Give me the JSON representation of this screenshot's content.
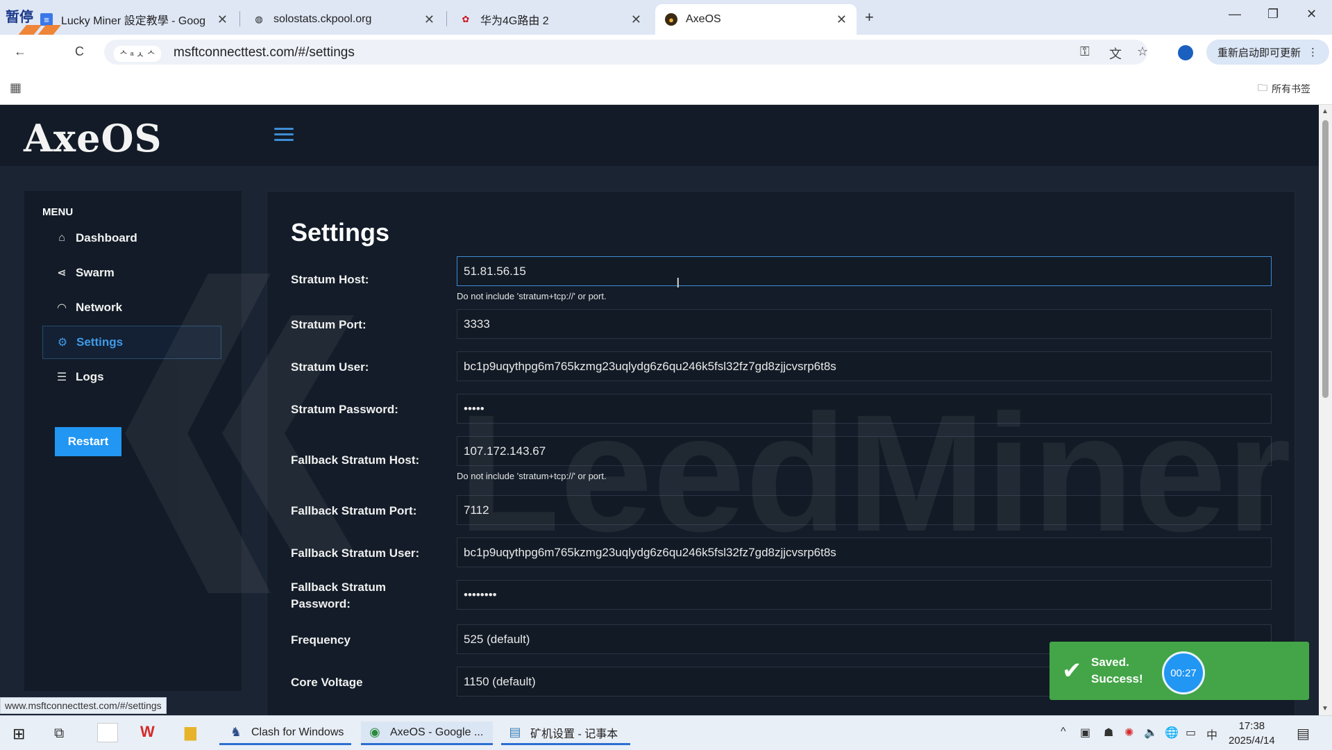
{
  "browser": {
    "tabs": [
      {
        "title": "Lucky Miner 設定教學 - Goog",
        "icon": "google-docs-icon"
      },
      {
        "title": "solostats.ckpool.org",
        "icon": "globe-icon"
      },
      {
        "title": "华为4G路由 2",
        "icon": "huawei-icon"
      },
      {
        "title": "AxeOS",
        "icon": "axeos-icon"
      }
    ],
    "corner_overlay_text": "暂停",
    "url": "msftconnecttest.com/#/settings",
    "site_chip": "ᄉ ᵃ ㅅ ᄉ",
    "update_button": "重新启动即可更新",
    "bookmarks_all": "所有书签",
    "status_url": "www.msftconnecttest.com/#/settings"
  },
  "app": {
    "brand": "AxeOS",
    "menu_title": "MENU",
    "nav": [
      {
        "label": "Dashboard",
        "icon": "home-icon"
      },
      {
        "label": "Swarm",
        "icon": "share-icon"
      },
      {
        "label": "Network",
        "icon": "wifi-icon"
      },
      {
        "label": "Settings",
        "icon": "gear-icon",
        "active": true
      },
      {
        "label": "Logs",
        "icon": "list-icon"
      }
    ],
    "restart_label": "Restart",
    "page_title": "Settings",
    "fields": {
      "stratum_host": {
        "label": "Stratum Host:",
        "value": "51.81.56.15",
        "hint": "Do not include 'stratum+tcp://' or port."
      },
      "stratum_port": {
        "label": "Stratum Port:",
        "value": "3333"
      },
      "stratum_user": {
        "label": "Stratum User:",
        "value": "bc1p9uqythpg6m765kzmg23uqlydg6z6qu246k5fsl32fz7gd8zjjcvsrp6t8s"
      },
      "stratum_password": {
        "label": "Stratum Password:",
        "value": "•••••"
      },
      "fallback_host": {
        "label": "Fallback Stratum Host:",
        "value": "107.172.143.67",
        "hint": "Do not include 'stratum+tcp://' or port."
      },
      "fallback_port": {
        "label": "Fallback Stratum Port:",
        "value": "7112"
      },
      "fallback_user": {
        "label": "Fallback Stratum User:",
        "value": "bc1p9uqythpg6m765kzmg23uqlydg6z6qu246k5fsl32fz7gd8zjjcvsrp6t8s"
      },
      "fallback_password": {
        "label": "Fallback Stratum Password:",
        "value": "••••••••"
      },
      "frequency": {
        "label": "Frequency",
        "value": "525 (default)"
      },
      "core_voltage": {
        "label": "Core Voltage",
        "value": "1150 (default)"
      }
    },
    "watermark": "LeedMiner",
    "toast": {
      "title": "Saved.",
      "message": "Success!",
      "timer": "00:27"
    }
  },
  "taskbar": {
    "apps": [
      {
        "label": "Clash for Windows",
        "icon": "clash-icon"
      },
      {
        "label": "AxeOS - Google ...",
        "icon": "chrome-icon"
      },
      {
        "label": "矿机设置 - 记事本",
        "icon": "notepad-icon"
      }
    ],
    "time": "17:38",
    "date": "2025/4/14"
  },
  "colors": {
    "app_bg": "#1b2432",
    "panel_bg": "#131c28",
    "accent": "#2196f3",
    "toast_bg": "#43a547"
  }
}
